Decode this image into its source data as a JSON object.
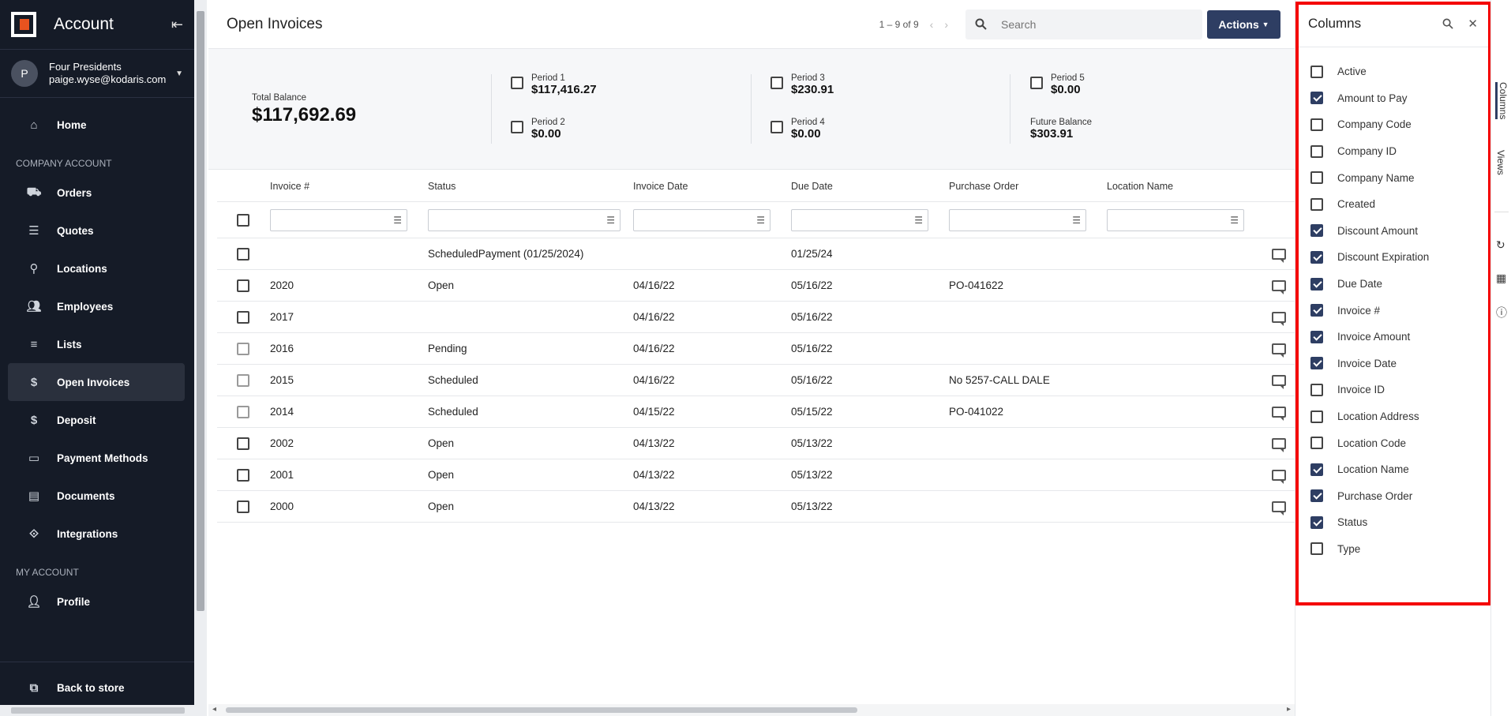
{
  "sidebar": {
    "title": "Account",
    "user": {
      "initial": "P",
      "name": "Four Presidents",
      "email": "paige.wyse@kodaris.com"
    },
    "home": "Home",
    "section_company": "COMPANY ACCOUNT",
    "items": [
      {
        "label": "Orders",
        "icon": "truck-icon"
      },
      {
        "label": "Quotes",
        "icon": "document-list-icon"
      },
      {
        "label": "Locations",
        "icon": "map-pin-icon"
      },
      {
        "label": "Employees",
        "icon": "people-icon"
      },
      {
        "label": "Lists",
        "icon": "list-icon"
      },
      {
        "label": "Open Invoices",
        "icon": "dollar-icon",
        "active": true
      },
      {
        "label": "Deposit",
        "icon": "dollar-icon"
      },
      {
        "label": "Payment Methods",
        "icon": "credit-card-icon"
      },
      {
        "label": "Documents",
        "icon": "document-icon"
      },
      {
        "label": "Integrations",
        "icon": "integration-icon"
      }
    ],
    "section_my": "MY ACCOUNT",
    "profile": "Profile",
    "back": "Back to store"
  },
  "header": {
    "title": "Open Invoices",
    "pager": "1 – 9 of 9",
    "search_placeholder": "Search",
    "actions": "Actions"
  },
  "summary": {
    "total_label": "Total Balance",
    "total_value": "$117,692.69",
    "periods": [
      {
        "label": "Period 1",
        "value": "$117,416.27"
      },
      {
        "label": "Period 2",
        "value": "$0.00"
      },
      {
        "label": "Period 3",
        "value": "$230.91"
      },
      {
        "label": "Period 4",
        "value": "$0.00"
      },
      {
        "label": "Period 5",
        "value": "$0.00"
      }
    ],
    "future_label": "Future Balance",
    "future_value": "$303.91"
  },
  "table": {
    "columns": [
      "Invoice #",
      "Status",
      "Invoice Date",
      "Due Date",
      "Purchase Order",
      "Location Name"
    ],
    "rows": [
      {
        "invoice": "",
        "status": "ScheduledPayment (01/25/2024)",
        "invoice_date": "",
        "due_date": "01/25/24",
        "po": "",
        "location": "",
        "light": false
      },
      {
        "invoice": "2020",
        "status": "Open",
        "invoice_date": "04/16/22",
        "due_date": "05/16/22",
        "po": "PO-041622",
        "location": "",
        "light": false
      },
      {
        "invoice": "2017",
        "status": "",
        "invoice_date": "04/16/22",
        "due_date": "05/16/22",
        "po": "",
        "location": "",
        "light": false
      },
      {
        "invoice": "2016",
        "status": "Pending",
        "invoice_date": "04/16/22",
        "due_date": "05/16/22",
        "po": "",
        "location": "",
        "light": true
      },
      {
        "invoice": "2015",
        "status": "Scheduled",
        "invoice_date": "04/16/22",
        "due_date": "05/16/22",
        "po": "No 5257-CALL DALE",
        "location": "",
        "light": true
      },
      {
        "invoice": "2014",
        "status": "Scheduled",
        "invoice_date": "04/15/22",
        "due_date": "05/15/22",
        "po": "PO-041022",
        "location": "",
        "light": true
      },
      {
        "invoice": "2002",
        "status": "Open",
        "invoice_date": "04/13/22",
        "due_date": "05/13/22",
        "po": "",
        "location": "",
        "light": false
      },
      {
        "invoice": "2001",
        "status": "Open",
        "invoice_date": "04/13/22",
        "due_date": "05/13/22",
        "po": "",
        "location": "",
        "light": false
      },
      {
        "invoice": "2000",
        "status": "Open",
        "invoice_date": "04/13/22",
        "due_date": "05/13/22",
        "po": "",
        "location": "",
        "light": false
      }
    ]
  },
  "columns_panel": {
    "title": "Columns",
    "items": [
      {
        "label": "Active",
        "checked": false
      },
      {
        "label": "Amount to Pay",
        "checked": true
      },
      {
        "label": "Company Code",
        "checked": false
      },
      {
        "label": "Company ID",
        "checked": false
      },
      {
        "label": "Company Name",
        "checked": false
      },
      {
        "label": "Created",
        "checked": false
      },
      {
        "label": "Discount Amount",
        "checked": true
      },
      {
        "label": "Discount Expiration",
        "checked": true
      },
      {
        "label": "Due Date",
        "checked": true
      },
      {
        "label": "Invoice #",
        "checked": true
      },
      {
        "label": "Invoice Amount",
        "checked": true
      },
      {
        "label": "Invoice Date",
        "checked": true
      },
      {
        "label": "Invoice ID",
        "checked": false
      },
      {
        "label": "Location Address",
        "checked": false
      },
      {
        "label": "Location Code",
        "checked": false
      },
      {
        "label": "Location Name",
        "checked": true
      },
      {
        "label": "Purchase Order",
        "checked": true
      },
      {
        "label": "Status",
        "checked": true
      },
      {
        "label": "Type",
        "checked": false
      }
    ]
  },
  "rail": {
    "columns_tab": "Columns",
    "views_tab": "Views"
  },
  "colors": {
    "sidebar_bg": "#151b27",
    "accent": "#2e3e63",
    "highlight": "#f40000"
  }
}
